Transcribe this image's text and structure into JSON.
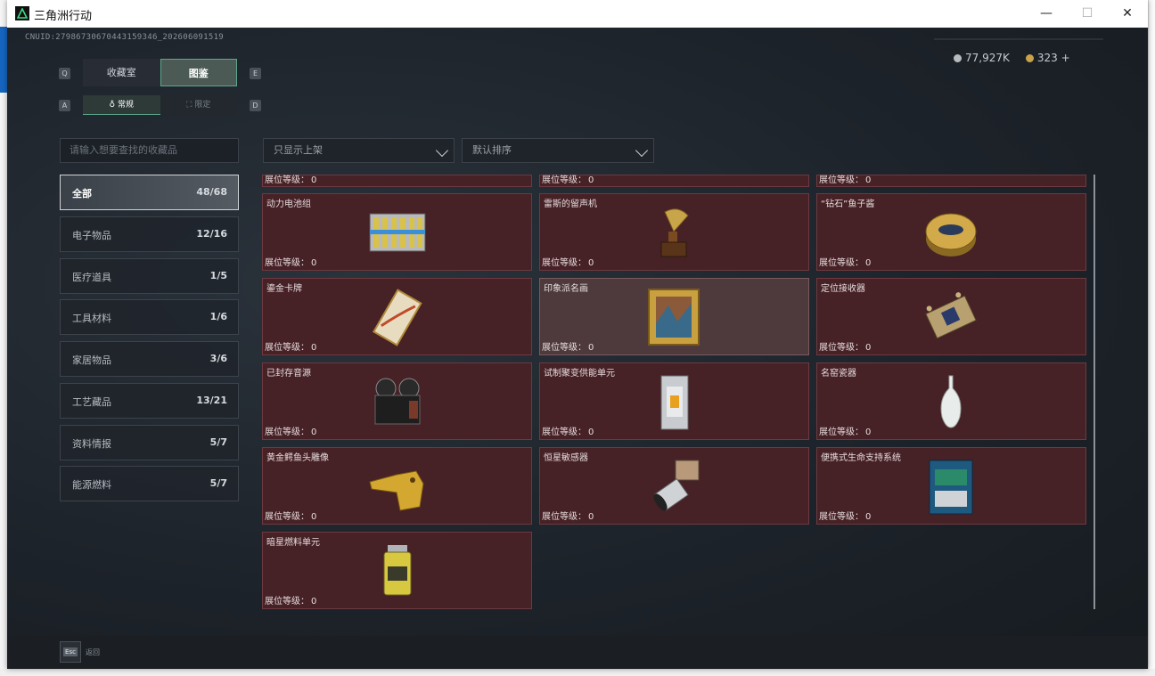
{
  "window": {
    "title": "三角洲行动",
    "min": "—",
    "max": "☐",
    "close": "✕"
  },
  "header": {
    "uid": "CNUID:2798673067044315934​6_202606091519",
    "silver": "77,927K",
    "gold": "323",
    "plus": "+"
  },
  "keyhints": {
    "q": "Q",
    "e": "E",
    "a": "A",
    "d": "D"
  },
  "tabs": [
    {
      "label": "收藏室"
    },
    {
      "label": "图鉴"
    }
  ],
  "subtabs": [
    {
      "label": "常规"
    },
    {
      "label": "限定"
    }
  ],
  "search": {
    "placeholder": "请输入想要查找的收藏品"
  },
  "filters": {
    "show": "只显示上架",
    "sort": "默认排序"
  },
  "categories": [
    {
      "label": "全部",
      "count": "48/68"
    },
    {
      "label": "电子物品",
      "count": "12/16"
    },
    {
      "label": "医疗道具",
      "count": "1/5"
    },
    {
      "label": "工具材料",
      "count": "1/6"
    },
    {
      "label": "家居物品",
      "count": "3/6"
    },
    {
      "label": "工艺藏品",
      "count": "13/21"
    },
    {
      "label": "资料情报",
      "count": "5/7"
    },
    {
      "label": "能源燃料",
      "count": "5/7"
    }
  ],
  "level_label": "展位等级：",
  "cards": [
    {
      "name": "",
      "level": "0"
    },
    {
      "name": "",
      "level": "0"
    },
    {
      "name": "",
      "level": "0"
    },
    {
      "name": "动力电池组",
      "level": "0"
    },
    {
      "name": "雷斯的留声机",
      "level": "0"
    },
    {
      "name": "“钻石”鱼子酱",
      "level": "0"
    },
    {
      "name": "鎏金卡牌",
      "level": "0"
    },
    {
      "name": "印象派名画",
      "level": "0"
    },
    {
      "name": "定位接收器",
      "level": "0"
    },
    {
      "name": "已封存音源",
      "level": "0"
    },
    {
      "name": "试制聚变供能单元",
      "level": "0"
    },
    {
      "name": "名窑瓷器",
      "level": "0"
    },
    {
      "name": "黄金鳄鱼头雕像",
      "level": "0"
    },
    {
      "name": "恒星敏感器",
      "level": "0"
    },
    {
      "name": "便携式生命支持系统",
      "level": "0"
    },
    {
      "name": "暗星燃料单元",
      "level": "0"
    }
  ],
  "footer": {
    "esc": "Esc",
    "back": "返回"
  }
}
